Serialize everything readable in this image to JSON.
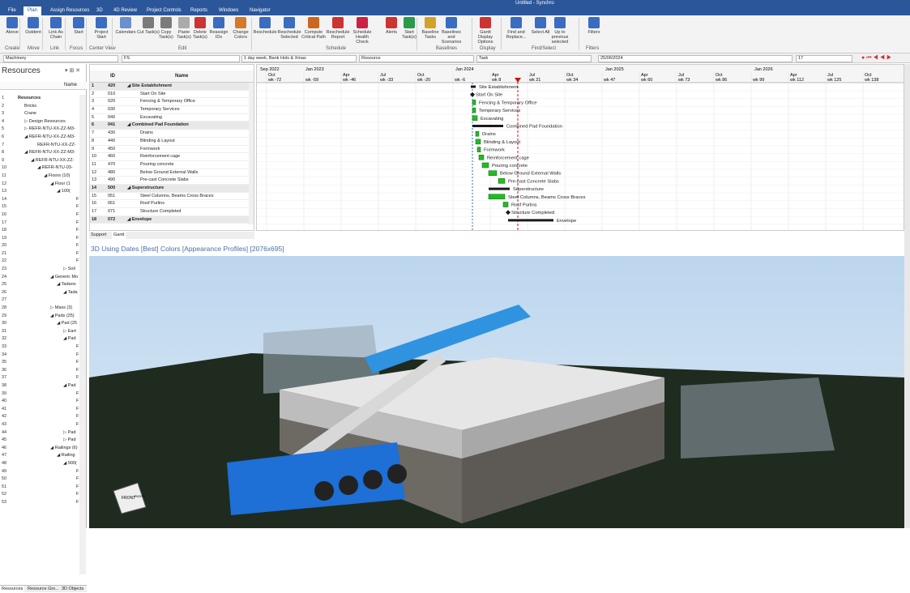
{
  "app": {
    "title": "Untitled - Synchro"
  },
  "menu": [
    "File",
    "Plan",
    "Assign Resources",
    "3D",
    "4D Review",
    "Project Controls",
    "Reports",
    "Windows",
    "Navigator"
  ],
  "menu_active": "Plan",
  "ribbon": {
    "buttons": [
      "Above",
      "Outdent",
      "Link As Chain",
      "Start",
      "Project Start",
      "Calendars",
      "Cut Task(s)",
      "Copy Task(s)",
      "Paste Task(s)",
      "Delete Task(s)",
      "Reassign IDs",
      "Change Colors",
      "Reschedule",
      "Reschedule Selected",
      "Compute Critical Path",
      "Reschedule Report",
      "Schedule Health Check",
      "Alerts",
      "Start Task(s)",
      "Baseline Tasks",
      "Baselines and Scenarios",
      "Gantt Display Options",
      "Find and Replace...",
      "Select All",
      "Up to previous selected",
      "Filters"
    ],
    "groups": [
      "Create",
      "Move",
      "Link",
      "Focus",
      "Center View",
      "Edit",
      "Schedule",
      "Baselines",
      "Display",
      "Find/Select",
      "Filters"
    ]
  },
  "filterbar": {
    "resource_type": "Machinery",
    "link_type": "FS",
    "calendar": "1 day week, Bank Hols & Xmas",
    "resource": "Resource",
    "task": "Task",
    "date": "25/06/2024",
    "number": "17"
  },
  "resources": {
    "title": "Resources",
    "header": "Name",
    "rows": [
      {
        "n": "1",
        "text": "Resources",
        "indent": 0,
        "bold": true
      },
      {
        "n": "2",
        "text": "Bricks",
        "indent": 1
      },
      {
        "n": "3",
        "text": "Crane",
        "indent": 1
      },
      {
        "n": "4",
        "text": "▷ Design Resources",
        "indent": 1
      },
      {
        "n": "5",
        "text": "▷ REFR-NTU-XX-ZZ-M3-",
        "indent": 1
      },
      {
        "n": "6",
        "text": "◢ REFR-NTU-XX-ZZ-M3-",
        "indent": 1
      },
      {
        "n": "7",
        "text": "REFR-NTU-XX-ZZ-",
        "indent": 3
      },
      {
        "n": "8",
        "text": "◢ REFR-NTU-XX-ZZ-M3-",
        "indent": 1
      },
      {
        "n": "9",
        "text": "◢ REFR-NTU-XX-ZZ-",
        "indent": 2
      },
      {
        "n": "10",
        "text": "◢ REFR-NTU-03-",
        "indent": 3
      },
      {
        "n": "11",
        "text": "◢ Floors (10)",
        "indent": 4
      },
      {
        "n": "12",
        "text": "◢ Floor (1",
        "indent": 5
      },
      {
        "n": "13",
        "text": "◢ 100(",
        "indent": 6
      },
      {
        "n": "14",
        "text": "F",
        "indent": 9
      },
      {
        "n": "15",
        "text": "F",
        "indent": 9
      },
      {
        "n": "16",
        "text": "F",
        "indent": 9
      },
      {
        "n": "17",
        "text": "F",
        "indent": 9
      },
      {
        "n": "18",
        "text": "F",
        "indent": 9
      },
      {
        "n": "19",
        "text": "F",
        "indent": 9
      },
      {
        "n": "20",
        "text": "F",
        "indent": 9
      },
      {
        "n": "21",
        "text": "F",
        "indent": 9
      },
      {
        "n": "22",
        "text": "F",
        "indent": 9
      },
      {
        "n": "23",
        "text": "▷ Soli",
        "indent": 7
      },
      {
        "n": "24",
        "text": "◢ Generic Mo",
        "indent": 5
      },
      {
        "n": "25",
        "text": "◢ Tadano",
        "indent": 6
      },
      {
        "n": "26",
        "text": "◢ Tada",
        "indent": 7
      },
      {
        "n": "27",
        "text": "",
        "indent": 9
      },
      {
        "n": "28",
        "text": "▷ Mass (3)",
        "indent": 5
      },
      {
        "n": "29",
        "text": "◢ Pads (25)",
        "indent": 5
      },
      {
        "n": "30",
        "text": "◢ Pad (25",
        "indent": 6
      },
      {
        "n": "31",
        "text": "▷ Eart",
        "indent": 7
      },
      {
        "n": "32",
        "text": "◢ Pad",
        "indent": 7
      },
      {
        "n": "33",
        "text": "F",
        "indent": 9
      },
      {
        "n": "34",
        "text": "F",
        "indent": 9
      },
      {
        "n": "35",
        "text": "F",
        "indent": 9
      },
      {
        "n": "36",
        "text": "F",
        "indent": 9
      },
      {
        "n": "37",
        "text": "F",
        "indent": 9
      },
      {
        "n": "38",
        "text": "◢ Pad",
        "indent": 7
      },
      {
        "n": "39",
        "text": "F",
        "indent": 9
      },
      {
        "n": "40",
        "text": "F",
        "indent": 9
      },
      {
        "n": "41",
        "text": "F",
        "indent": 9
      },
      {
        "n": "42",
        "text": "F",
        "indent": 9
      },
      {
        "n": "43",
        "text": "F",
        "indent": 9
      },
      {
        "n": "44",
        "text": "▷ Pad",
        "indent": 7
      },
      {
        "n": "45",
        "text": "▷ Pad",
        "indent": 7
      },
      {
        "n": "46",
        "text": "◢ Railings (6)",
        "indent": 5
      },
      {
        "n": "47",
        "text": "◢ Railing",
        "indent": 6
      },
      {
        "n": "48",
        "text": "◢ 900(",
        "indent": 7
      },
      {
        "n": "49",
        "text": "F",
        "indent": 9
      },
      {
        "n": "50",
        "text": "F",
        "indent": 9
      },
      {
        "n": "51",
        "text": "F",
        "indent": 9
      },
      {
        "n": "52",
        "text": "F",
        "indent": 9
      },
      {
        "n": "53",
        "text": "F",
        "indent": 9
      }
    ],
    "tabs": [
      "Resources",
      "Resource Gro...",
      "3D Objects"
    ]
  },
  "tasks": {
    "headers": {
      "id": "ID",
      "name": "Name"
    },
    "rows": [
      {
        "row": "1",
        "id": "420",
        "name": "◢ Site Establishment",
        "sum": true,
        "indent": 0
      },
      {
        "row": "2",
        "id": "010",
        "name": "Start On Site",
        "indent": 1
      },
      {
        "row": "3",
        "id": "020",
        "name": "Fencing & Temporary Office",
        "indent": 1
      },
      {
        "row": "4",
        "id": "030",
        "name": "Temporary Services",
        "indent": 1
      },
      {
        "row": "5",
        "id": "040",
        "name": "Excavating",
        "indent": 1
      },
      {
        "row": "6",
        "id": "041",
        "name": "◢ Combined Pad Foundation",
        "sum": true,
        "indent": 0
      },
      {
        "row": "7",
        "id": "430",
        "name": "Drains",
        "indent": 1
      },
      {
        "row": "8",
        "id": "440",
        "name": "Blinding & Layout",
        "indent": 1
      },
      {
        "row": "9",
        "id": "450",
        "name": "Formwork",
        "indent": 1
      },
      {
        "row": "10",
        "id": "460",
        "name": "Reinforcement cage",
        "indent": 1
      },
      {
        "row": "11",
        "id": "470",
        "name": "Pouring concrete",
        "indent": 1
      },
      {
        "row": "12",
        "id": "480",
        "name": "Below Ground External Walls",
        "indent": 1
      },
      {
        "row": "13",
        "id": "490",
        "name": "Pre-cast Concrete Slabs",
        "indent": 1
      },
      {
        "row": "14",
        "id": "500",
        "name": "◢ Superstructure",
        "sum": true,
        "indent": 0
      },
      {
        "row": "15",
        "id": "051",
        "name": "Steel Columns, Beams Cross Braces",
        "indent": 1
      },
      {
        "row": "16",
        "id": "061",
        "name": "Roof Purlins",
        "indent": 1
      },
      {
        "row": "17",
        "id": "071",
        "name": "Structure Completed",
        "indent": 1
      },
      {
        "row": "18",
        "id": "072",
        "name": "◢ Envelope",
        "sum": true,
        "indent": 0
      }
    ],
    "tabs": [
      "Support",
      "Gantt"
    ]
  },
  "gantt": {
    "months": [
      "Sep 2022",
      "Jan 2023",
      "Jan 2024",
      "Jan 2025",
      "Jan 2026"
    ],
    "months2": [
      "Oct",
      "Apr",
      "Jul",
      "Oct",
      "Apr",
      "Jul",
      "Oct",
      "Apr",
      "Jul",
      "Oct",
      "Apr",
      "Jul",
      "Oct"
    ],
    "weeks": [
      "wk -72",
      "wk -59",
      "wk -46",
      "wk -33",
      "wk -20",
      "wk -6",
      "wk 8",
      "wk 21",
      "wk 34",
      "wk 47",
      "wk 60",
      "wk 73",
      "wk 86",
      "wk 99",
      "wk 112",
      "wk 125",
      "wk 138"
    ],
    "labels": [
      "Site Establishment",
      "Start On Site",
      "Fencing & Temporary Office",
      "Temporary Services",
      "Excavating",
      "Combined Pad Foundation",
      "Drains",
      "Blinding & Layout",
      "Formwork",
      "Reinforcement cage",
      "Pouring concrete",
      "Below Ground External Walls",
      "Pre-cast Concrete Slabs",
      "Superstructure",
      "Steel Columns, Beams Cross Braces",
      "Roof Purlins",
      "Structure Completed",
      "Envelope"
    ],
    "colors": {
      "critical": "#1a1a1a",
      "progress": "#22bb22",
      "today": "#cc1111",
      "start": "#2a6fbf"
    }
  },
  "view3d": {
    "title": "3D Using Dates [Best] Colors [Appearance Profiles]  [2076x695]",
    "cube_front": "FRONT",
    "cube_right": "RIGHT"
  }
}
